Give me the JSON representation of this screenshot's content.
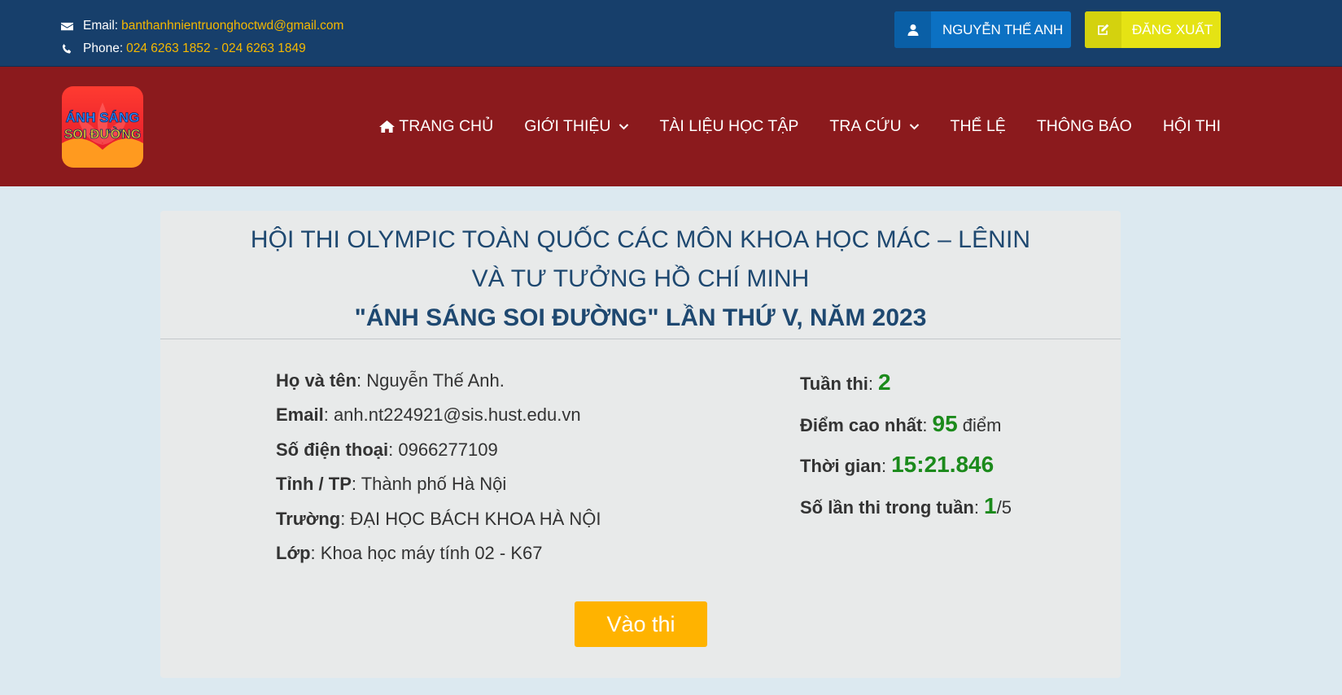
{
  "topbar": {
    "email_label": "Email:",
    "email_value": "banthanhnientruonghoctwd@gmail.com",
    "phone_label": "Phone:",
    "phone_value": "024 6263 1852 - 024 6263 1849",
    "user_button": "NGUYỄN THẾ ANH",
    "logout_button": "ĐĂNG XUẤT"
  },
  "logo": {
    "line1": "ÁNH SÁNG",
    "line2": "SOI ĐƯỜNG"
  },
  "nav": {
    "items": [
      {
        "label": "TRANG CHỦ"
      },
      {
        "label": "GIỚI THIỆU"
      },
      {
        "label": "TÀI LIỆU HỌC TẬP"
      },
      {
        "label": "TRA CỨU"
      },
      {
        "label": "THỂ LỆ"
      },
      {
        "label": "THÔNG BÁO"
      },
      {
        "label": "HỘI THI"
      }
    ]
  },
  "contest": {
    "title_line1": "HỘI THI OLYMPIC TOÀN QUỐC CÁC MÔN KHOA HỌC MÁC – LÊNIN",
    "title_line2": "VÀ TƯ TƯỞNG HỒ CHÍ MINH",
    "title_line3": "\"ÁNH SÁNG SOI ĐƯỜNG\" LẦN THỨ V, NĂM 2023"
  },
  "profile": {
    "name_label": "Họ và tên",
    "name": "Nguyễn Thế Anh.",
    "email_label": "Email",
    "email": "anh.nt224921@sis.hust.edu.vn",
    "phone_label": "Số điện thoại",
    "phone": "0966277109",
    "province_label": "Tỉnh / TP",
    "province": "Thành phố Hà Nội",
    "school_label": "Trường",
    "school": "ĐẠI HỌC BÁCH KHOA HÀ NỘI",
    "class_label": "Lớp",
    "class": "Khoa học máy tính 02 - K67"
  },
  "stats": {
    "week_label": "Tuần thi",
    "week": "2",
    "score_label": "Điểm cao nhất",
    "score": "95",
    "score_unit": "điểm",
    "time_label": "Thời gian",
    "time": "15:21.846",
    "attempts_label": "Số lần thi trong tuần",
    "attempts": "1",
    "attempts_max": "/5"
  },
  "actions": {
    "start_button": "Vào thi"
  },
  "colors": {
    "topbar": "#173f6b",
    "navbar": "#8b1a1d",
    "accent_yellow": "#f5b800",
    "stat_green": "#1b8a1b",
    "start_button": "#ffb300"
  }
}
